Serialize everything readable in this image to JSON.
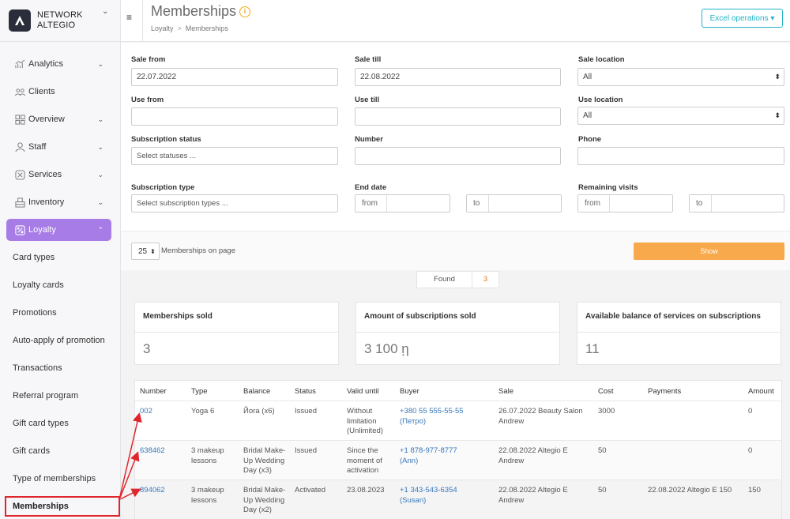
{
  "brand": {
    "line1": "NETWORK",
    "line2": "ALTEGIO"
  },
  "sidebar": {
    "items": [
      {
        "label": "Analytics",
        "icon": "analytics-icon",
        "chevron": "⌄"
      },
      {
        "label": "Clients",
        "icon": "clients-icon"
      },
      {
        "label": "Overview",
        "icon": "overview-icon",
        "chevron": "⌄"
      },
      {
        "label": "Staff",
        "icon": "staff-icon",
        "chevron": "⌄"
      },
      {
        "label": "Services",
        "icon": "services-icon",
        "chevron": "⌄"
      },
      {
        "label": "Inventory",
        "icon": "inventory-icon",
        "chevron": "⌄"
      },
      {
        "label": "Loyalty",
        "icon": "loyalty-icon",
        "chevron": "⌃"
      }
    ],
    "loyalty_subitems": [
      "Card types",
      "Loyalty cards",
      "Promotions",
      "Auto-apply of promotion",
      "Transactions",
      "Referral program",
      "Gift card types",
      "Gift cards",
      "Type of memberships",
      "Memberships"
    ]
  },
  "header": {
    "title": "Memberships",
    "info_icon": "i",
    "breadcrumb": [
      "Loyalty",
      "Memberships"
    ],
    "breadcrumb_sep": ">",
    "excel_button": "Excel operations ▾",
    "menu_icon": "≡"
  },
  "filters": {
    "sale_from": {
      "label": "Sale from",
      "value": "22.07.2022"
    },
    "sale_till": {
      "label": "Sale till",
      "value": "22.08.2022"
    },
    "sale_location": {
      "label": "Sale location",
      "value": "All"
    },
    "use_from": {
      "label": "Use from",
      "value": ""
    },
    "use_till": {
      "label": "Use till",
      "value": ""
    },
    "use_location": {
      "label": "Use location",
      "value": "All"
    },
    "subscription_status": {
      "label": "Subscription status",
      "placeholder": "Select statuses ..."
    },
    "number": {
      "label": "Number",
      "value": ""
    },
    "phone": {
      "label": "Phone",
      "value": ""
    },
    "subscription_type": {
      "label": "Subscription type",
      "placeholder": "Select subscription types ..."
    },
    "end_date": {
      "label": "End date",
      "from": "from",
      "to": "to"
    },
    "remaining_visits": {
      "label": "Remaining visits",
      "from": "from",
      "to": "to"
    },
    "per_page": "25",
    "per_page_label": "Memberships on page",
    "show_button": "Show"
  },
  "found": {
    "label": "Found",
    "value": "3"
  },
  "stats": [
    {
      "title": "Memberships sold",
      "value": "3"
    },
    {
      "title": "Amount of subscriptions sold",
      "value": "3 100 ῃ"
    },
    {
      "title": "Available balance of services on subscriptions",
      "value": "11"
    }
  ],
  "table": {
    "columns": [
      "Number",
      "Type",
      "Balance",
      "Status",
      "Valid until",
      "Buyer",
      "Sale",
      "Cost",
      "Payments",
      "Amount"
    ],
    "rows": [
      {
        "number": "002",
        "type": "Yoga 6",
        "balance": "Йога (x6)",
        "status": "Issued",
        "valid_until": "Without limitation (Unlimited)",
        "buyer_phone": "+380 55 555-55-55",
        "buyer_name": "(Петро)",
        "sale": "26.07.2022 Beauty Salon Andrew",
        "cost": "3000",
        "payments": "",
        "amount": "0"
      },
      {
        "number": "638462",
        "type": "3 makeup lessons",
        "balance": "Bridal Make-Up Wedding Day (x3)",
        "status": "Issued",
        "valid_until": "Since the moment of activation",
        "buyer_phone": "+1 878-977-8777",
        "buyer_name": "(Ann)",
        "sale": "22.08.2022 Altegio E Andrew",
        "cost": "50",
        "payments": "",
        "amount": "0"
      },
      {
        "number": "894062",
        "type": "3 makeup lessons",
        "balance": "Bridal Make-Up Wedding Day (x2)",
        "status": "Activated",
        "valid_until": "23.08.2023",
        "buyer_phone": "+1 343-543-6354",
        "buyer_name": "(Susan)",
        "sale": "22.08.2022 Altegio E Andrew",
        "cost": "50",
        "payments": "22.08.2022 Altegio E 150",
        "amount": "150"
      }
    ]
  },
  "colors": {
    "accent_purple": "#a77ce6",
    "link_blue": "#3a78b8",
    "teal": "#24b3c6",
    "orange": "#f7a94b",
    "annotation_red": "#e0252c"
  }
}
